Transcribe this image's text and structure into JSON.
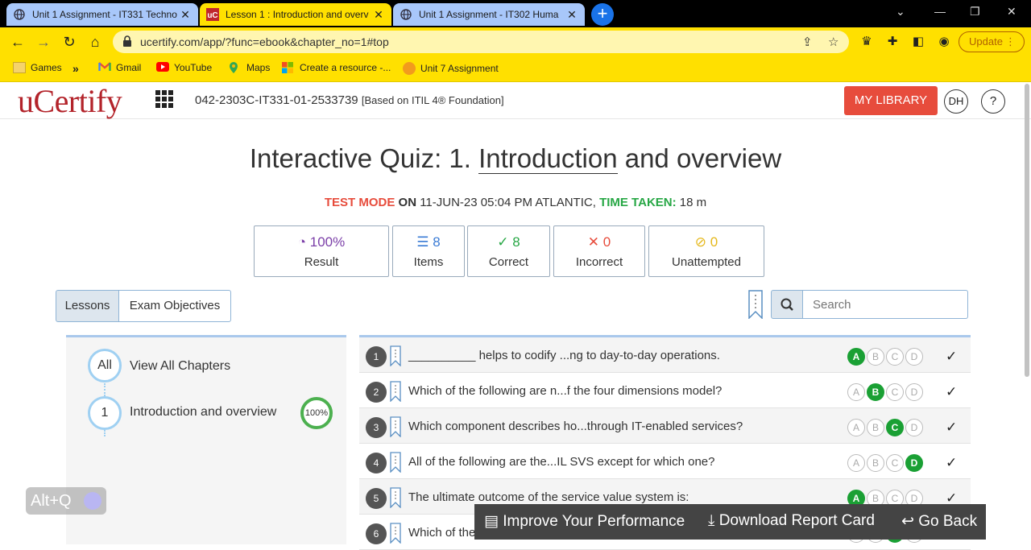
{
  "browser": {
    "tabs": [
      {
        "title": "Unit 1 Assignment - IT331 Techno",
        "active": false
      },
      {
        "title": "Lesson 1 : Introduction and overv",
        "active": true
      },
      {
        "title": "Unit 1 Assignment - IT302 Huma",
        "active": false
      }
    ],
    "new_tab": "+",
    "url": "ucertify.com/app/?func=ebook&chapter_no=1#top",
    "update_label": "Update",
    "bookmarks": [
      "Games",
      "Gmail",
      "YouTube",
      "Maps",
      "Create a resource -...",
      "Unit 7 Assignment"
    ]
  },
  "header": {
    "logo": "uCertify",
    "course_code": "042-2303C-IT331-01-2533739",
    "course_suffix": "[Based on ITIL 4® Foundation]",
    "my_library": "MY LIBRARY",
    "avatar": "DH",
    "help": "?"
  },
  "quiz": {
    "title_prefix": "Interactive Quiz: 1. ",
    "title_underlined": "Introduction",
    "title_suffix": " and overview",
    "mode_label": "TEST MODE",
    "mode_on": "ON",
    "date": "11-JUN-23 05:04 PM ATLANTIC,",
    "time_label": "TIME TAKEN:",
    "time_value": "18 m"
  },
  "stats": [
    {
      "value": "100%",
      "label": "Result",
      "color": "#7b3fa8"
    },
    {
      "value": "8",
      "label": "Items",
      "color": "#3a7bd5"
    },
    {
      "value": "8",
      "label": "Correct",
      "color": "#27a745"
    },
    {
      "value": "0",
      "label": "Incorrect",
      "color": "#e74c3c"
    },
    {
      "value": "0",
      "label": "Unattempted",
      "color": "#e5b81b"
    }
  ],
  "tabs": {
    "lessons": "Lessons",
    "objectives": "Exam Objectives"
  },
  "search": {
    "placeholder": "Search"
  },
  "chapters": {
    "all_badge": "All",
    "all_label": "View All Chapters",
    "ch1_badge": "1",
    "ch1_label": "Introduction and overview",
    "ch1_pct": "100%"
  },
  "questions": [
    {
      "num": "1",
      "text": "__________ helps to codify ...ng to day-to-day operations.",
      "answer": "A"
    },
    {
      "num": "2",
      "text": "Which of the following are n...f the four dimensions model?",
      "answer": "B"
    },
    {
      "num": "3",
      "text": "Which component describes ho...through IT-enabled services?",
      "answer": "C"
    },
    {
      "num": "4",
      "text": "All of the following are the...IL SVS except for which one?",
      "answer": "D"
    },
    {
      "num": "5",
      "text": "The ultimate outcome of the service value system is:",
      "answer": "A"
    },
    {
      "num": "6",
      "text": "Which of the following comp...efficiency, and experience?",
      "answer": "C"
    }
  ],
  "options": [
    "A",
    "B",
    "C",
    "D"
  ],
  "bottom_bar": {
    "improve": "Improve Your Performance",
    "download": "Download Report Card",
    "back": "Go Back"
  },
  "overlay": {
    "altq": "Alt+Q"
  }
}
